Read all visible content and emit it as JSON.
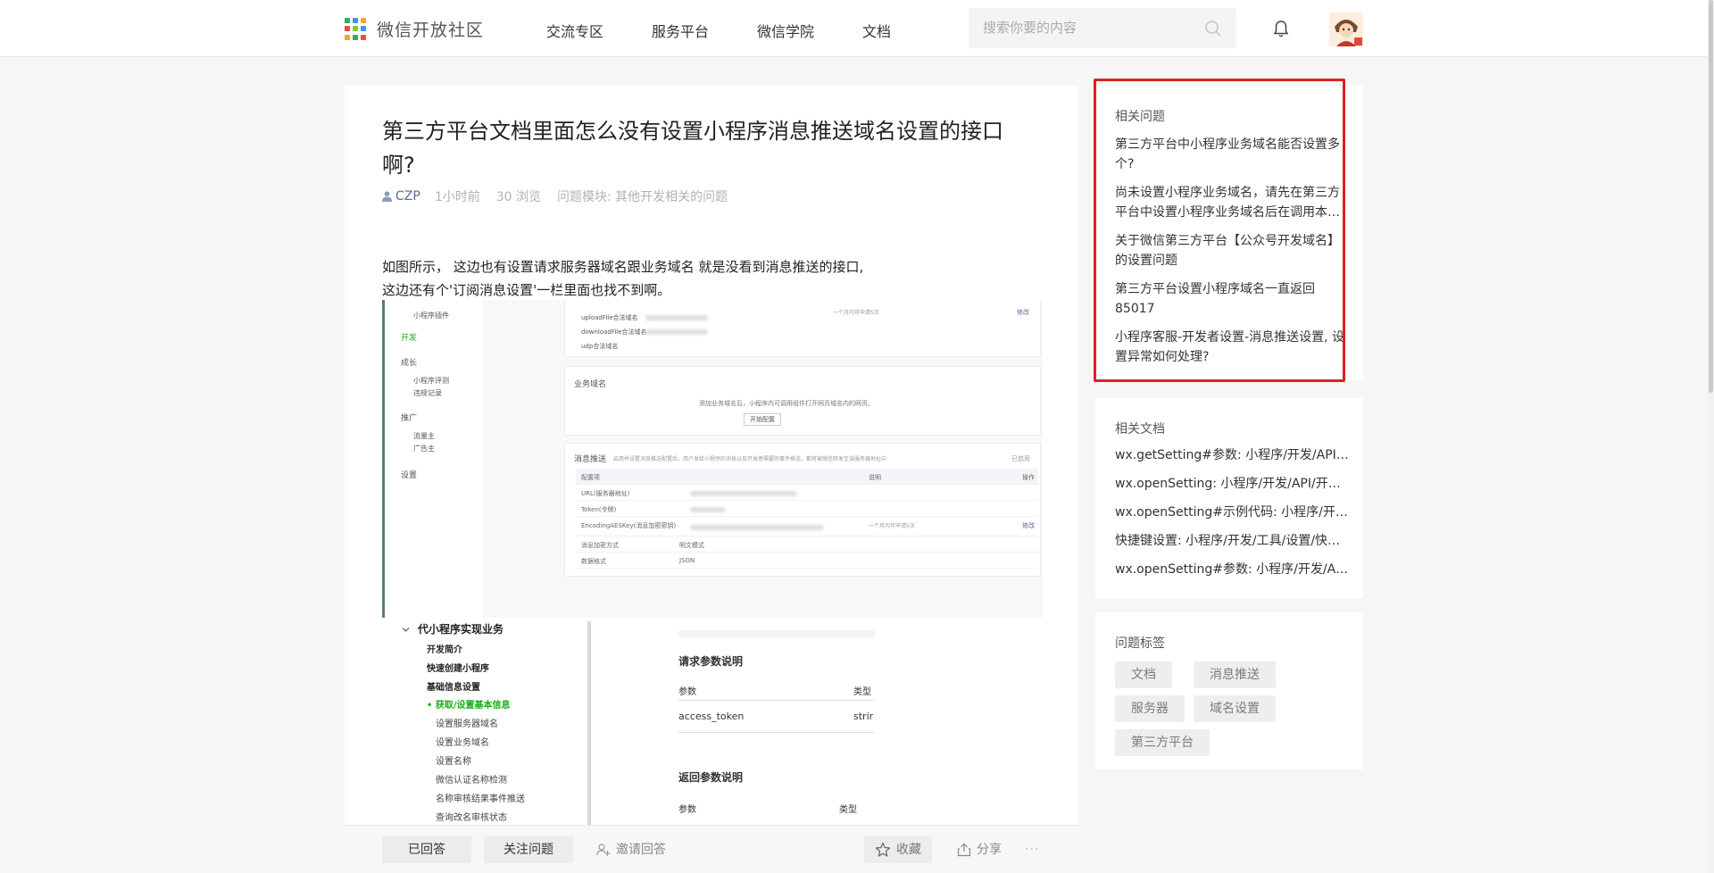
{
  "header": {
    "logo_text": "微信开放社区",
    "nav": [
      "交流专区",
      "服务平台",
      "微信学院",
      "文档"
    ],
    "search_placeholder": "搜索你要的内容"
  },
  "question": {
    "title": "第三方平台文档里面怎么没有设置小程序消息推送域名设置的接口啊?",
    "author": "CZP",
    "time": "1小时前",
    "views": "30 浏览",
    "module": "问题模块: 其他开发相关的问题",
    "body_line1": "如图所示， 这边也有设置请求服务器域名跟业务域名 就是没看到消息推送的接口,",
    "body_line2": "这边还有个'订阅消息设置'一栏里面也找不到啊。"
  },
  "shot1": {
    "side": [
      "开发",
      "成长",
      "小程序评测",
      "违规记录",
      "推广",
      "流量主",
      "广告主",
      "设置"
    ],
    "server_rows": [
      "uploadFile合法域名",
      "downloadFile合法域名",
      "udp合法域名"
    ],
    "server_note": "一个月内可申请5次",
    "business_title": "业务域名",
    "business_desc": "添加业务域名后，小程序内可调用组件打开网页域名内的网页。",
    "business_btn": "开始配置",
    "push_title": "消息推送",
    "push_desc": "启用并设置消息推送配置后，用户发给小程序的消息以及开发者需要的事件推送，都将被微信转发至该服务器地址中",
    "push_status": "已启用",
    "push_head": [
      "配置项",
      "说明",
      "操作"
    ],
    "push_rows": [
      "URL(服务器地址)",
      "Token(令牌)",
      "EncodingAESKey(消息加密密钥)",
      "消息加密方式",
      "数据格式"
    ],
    "push_values": [
      "明文模式",
      "JSON"
    ],
    "modify": "修改"
  },
  "shot2": {
    "section": "代小程序实现业务",
    "items": [
      "开发简介",
      "快速创建小程序",
      "基础信息设置",
      "获取/设置基本信息",
      "设置服务器域名",
      "设置业务域名",
      "设置名称",
      "微信认证名称检测",
      "名称审核结果事件推送",
      "查询改名审核状态"
    ],
    "req_title": "请求参数说明",
    "req_head": [
      "参数",
      "类型"
    ],
    "req_row": [
      "access_token",
      "strir"
    ],
    "resp_title": "返回参数说明",
    "resp_head": [
      "参数",
      "类型"
    ]
  },
  "footer": {
    "answered": "已回答",
    "follow": "关注问题",
    "invite": "邀请回答",
    "collect": "收藏",
    "share": "分享",
    "more": "···"
  },
  "related_questions": {
    "title": "相关问题",
    "items": [
      "第三方平台中小程序业务域名能否设置多个?",
      "尚未设置小程序业务域名，请先在第三方平台中设置小程序业务域名后在调用本接口",
      "关于微信第三方平台【公众号开发域名】的设置问题",
      "第三方平台设置小程序域名一直返回85017",
      "小程序客服-开发者设置-消息推送设置, 设置异常如何处理?"
    ]
  },
  "related_docs": {
    "title": "相关文档",
    "items": [
      "wx.getSetting#参数: 小程序/开发/API/开放接口/设置",
      "wx.openSetting: 小程序/开发/API/开放接口/设置",
      "wx.openSetting#示例代码: 小程序/开发/API/开放接口",
      "快捷键设置: 小程序/开发/工具/设置/快捷键",
      "wx.openSetting#参数: 小程序/开发/API/开放接口"
    ]
  },
  "tags": {
    "title": "问题标签",
    "items": [
      "文档",
      "消息推送",
      "服务器",
      "域名设置",
      "第三方平台"
    ]
  },
  "colors": {
    "accent_red": "#e02020",
    "link_blue": "#576b95",
    "green": "#1aad19"
  }
}
